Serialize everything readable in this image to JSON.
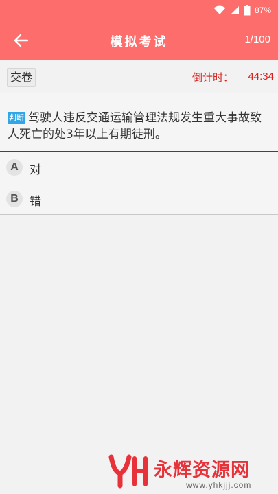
{
  "status_bar": {
    "battery_percent": "87%",
    "icons": [
      "wifi-icon",
      "signal-icon",
      "battery-icon"
    ]
  },
  "app_bar": {
    "back_icon": "arrow-left-icon",
    "title": "模拟考试",
    "progress": "1/100"
  },
  "toolbar": {
    "submit_label": "交卷",
    "countdown_label": "倒计时：",
    "countdown_value": "44:34"
  },
  "question": {
    "type_badge": "判断",
    "text": "驾驶人违反交通运输管理法规发生重大事故致人死亡的处3年以上有期徒刑。"
  },
  "options": [
    {
      "letter": "A",
      "text": "对"
    },
    {
      "letter": "B",
      "text": "错"
    }
  ],
  "watermark": {
    "logo_text": "YH",
    "name": "永辉资源网",
    "url": "www.yhkjjj.com"
  },
  "colors": {
    "header": "#fc6d6b",
    "countdown": "#d9201c",
    "badge": "#2ea6e8",
    "watermark": "#e8323a"
  }
}
